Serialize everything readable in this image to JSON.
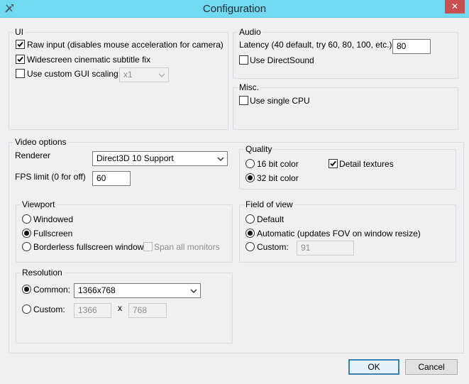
{
  "window": {
    "title": "Configuration",
    "close_glyph": "✕"
  },
  "ui": {
    "legend": "UI",
    "raw_input": {
      "label": "Raw input (disables mouse acceleration for camera)",
      "checked": true
    },
    "widescreen": {
      "label": "Widescreen cinematic subtitle fix",
      "checked": true
    },
    "custom_gui": {
      "label": "Use custom GUI scaling:",
      "checked": false
    },
    "gui_scale_value": "x1"
  },
  "audio": {
    "legend": "Audio",
    "latency_label": "Latency (40 default, try 60, 80, 100, etc.)",
    "latency_value": "80",
    "directsound": {
      "label": "Use DirectSound",
      "checked": false
    }
  },
  "misc": {
    "legend": "Misc.",
    "single_cpu": {
      "label": "Use single CPU",
      "checked": false
    }
  },
  "video": {
    "legend": "Video options",
    "renderer_label": "Renderer",
    "renderer_value": "Direct3D 10 Support",
    "fps_label": "FPS limit (0 for off)",
    "fps_value": "60"
  },
  "quality": {
    "legend": "Quality",
    "bit16": "16 bit color",
    "bit32": "32 bit color",
    "selected": "32 bit color",
    "detail": {
      "label": "Detail textures",
      "checked": true
    }
  },
  "viewport": {
    "legend": "Viewport",
    "windowed": "Windowed",
    "fullscreen": "Fullscreen",
    "borderless": "Borderless fullscreen window",
    "selected": "Fullscreen",
    "span": {
      "label": "Span all monitors",
      "checked": false
    }
  },
  "fov": {
    "legend": "Field of view",
    "default": "Default",
    "automatic": "Automatic (updates FOV on window resize)",
    "custom": "Custom:",
    "selected": "Automatic (updates FOV on window resize)",
    "custom_value": "91"
  },
  "resolution": {
    "legend": "Resolution",
    "common": "Common:",
    "common_value": "1366x768",
    "custom": "Custom:",
    "width": "1366",
    "separator": "x",
    "height": "768",
    "selected": "Common:"
  },
  "buttons": {
    "ok": "OK",
    "cancel": "Cancel"
  },
  "colors": {
    "titlebar": "#71d9f0",
    "close": "#c75050",
    "default_button_border": "#3c7fb1"
  },
  "icons": {
    "app": "wrench-screwdriver-icon",
    "close": "close-icon",
    "check": "checkmark-icon",
    "dropdown": "chevron-down-icon"
  }
}
